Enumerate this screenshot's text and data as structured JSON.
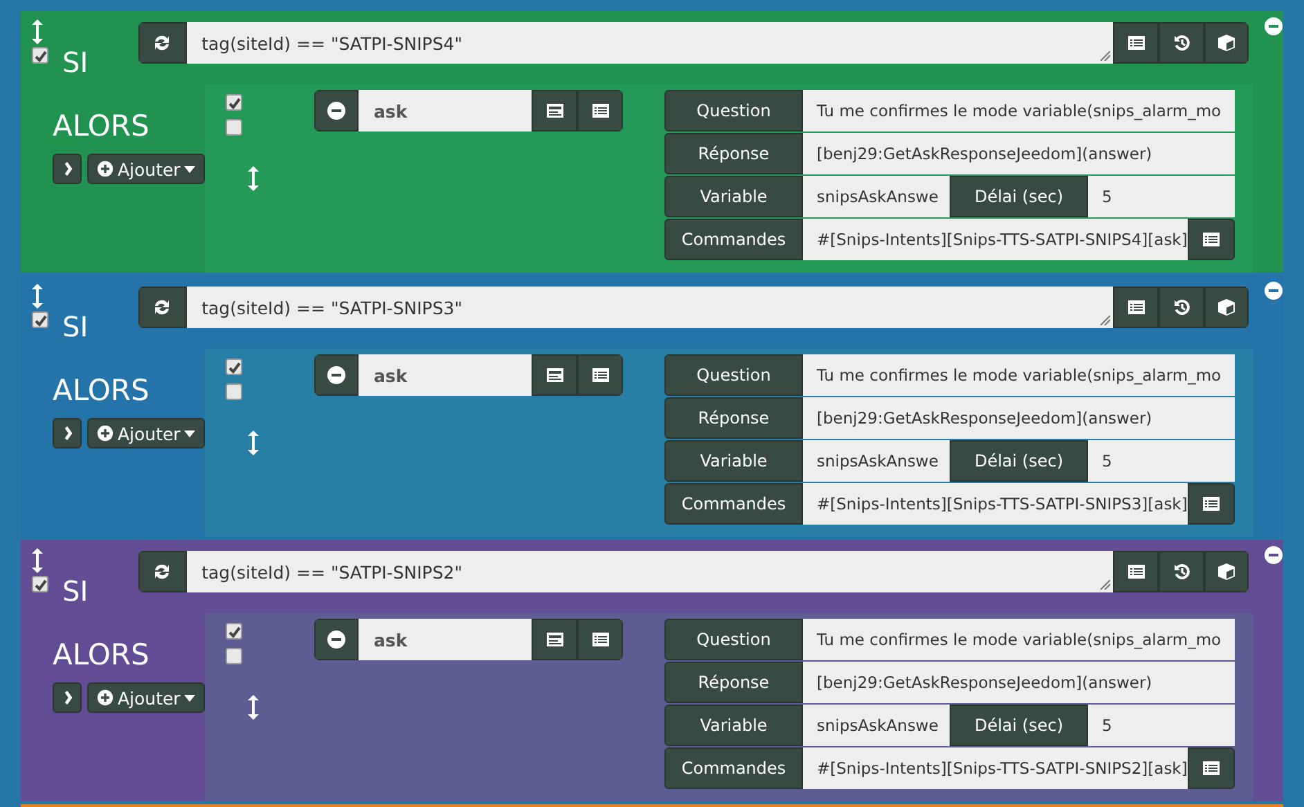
{
  "blocks": [
    {
      "color": "#229250",
      "if_label": "SI",
      "enabled": true,
      "condition": "tag(siteId) == \"SATPI-SNIPS4\"",
      "then_label": "ALORS",
      "add_label": "Ajouter",
      "action": {
        "enabled": true,
        "background": false,
        "name": "ask",
        "question_label": "Question",
        "question": "Tu me confirmes le mode variable(snips_alarm_mo",
        "answer_label": "Réponse",
        "answer": "[benj29:GetAskResponseJeedom](answer)",
        "variable_label": "Variable",
        "variable": "snipsAskAnswe",
        "delay_label": "Délai (sec)",
        "delay": "5",
        "commands_label": "Commandes",
        "commands": "#[Snips-Intents][Snips-TTS-SATPI-SNIPS4][ask]"
      }
    },
    {
      "color": "#2574a9",
      "if_label": "SI",
      "enabled": true,
      "condition": "tag(siteId) == \"SATPI-SNIPS3\"",
      "then_label": "ALORS",
      "add_label": "Ajouter",
      "action": {
        "enabled": true,
        "background": false,
        "name": "ask",
        "question_label": "Question",
        "question": "Tu me confirmes le mode variable(snips_alarm_mo",
        "answer_label": "Réponse",
        "answer": "[benj29:GetAskResponseJeedom](answer)",
        "variable_label": "Variable",
        "variable": "snipsAskAnswe",
        "delay_label": "Délai (sec)",
        "delay": "5",
        "commands_label": "Commandes",
        "commands": "#[Snips-Intents][Snips-TTS-SATPI-SNIPS3][ask]"
      }
    },
    {
      "color": "#624d94",
      "if_label": "SI",
      "enabled": true,
      "condition": "tag(siteId) == \"SATPI-SNIPS2\"",
      "then_label": "ALORS",
      "add_label": "Ajouter",
      "action": {
        "enabled": true,
        "background": false,
        "name": "ask",
        "question_label": "Question",
        "question": "Tu me confirmes le mode variable(snips_alarm_mo",
        "answer_label": "Réponse",
        "answer": "[benj29:GetAskResponseJeedom](answer)",
        "variable_label": "Variable",
        "variable": "snipsAskAnswe",
        "delay_label": "Délai (sec)",
        "delay": "5",
        "commands_label": "Commandes",
        "commands": "#[Snips-Intents][Snips-TTS-SATPI-SNIPS2][ask]"
      }
    }
  ]
}
